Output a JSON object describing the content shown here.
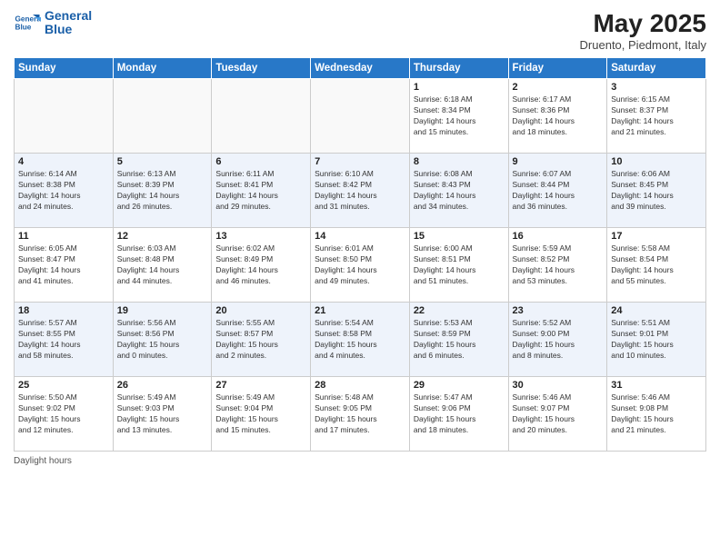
{
  "logo": {
    "text_general": "General",
    "text_blue": "Blue"
  },
  "header": {
    "month": "May 2025",
    "location": "Druento, Piedmont, Italy"
  },
  "days_of_week": [
    "Sunday",
    "Monday",
    "Tuesday",
    "Wednesday",
    "Thursday",
    "Friday",
    "Saturday"
  ],
  "weeks": [
    {
      "alt": false,
      "days": [
        {
          "num": "",
          "info": ""
        },
        {
          "num": "",
          "info": ""
        },
        {
          "num": "",
          "info": ""
        },
        {
          "num": "",
          "info": ""
        },
        {
          "num": "1",
          "info": "Sunrise: 6:18 AM\nSunset: 8:34 PM\nDaylight: 14 hours\nand 15 minutes."
        },
        {
          "num": "2",
          "info": "Sunrise: 6:17 AM\nSunset: 8:36 PM\nDaylight: 14 hours\nand 18 minutes."
        },
        {
          "num": "3",
          "info": "Sunrise: 6:15 AM\nSunset: 8:37 PM\nDaylight: 14 hours\nand 21 minutes."
        }
      ]
    },
    {
      "alt": true,
      "days": [
        {
          "num": "4",
          "info": "Sunrise: 6:14 AM\nSunset: 8:38 PM\nDaylight: 14 hours\nand 24 minutes."
        },
        {
          "num": "5",
          "info": "Sunrise: 6:13 AM\nSunset: 8:39 PM\nDaylight: 14 hours\nand 26 minutes."
        },
        {
          "num": "6",
          "info": "Sunrise: 6:11 AM\nSunset: 8:41 PM\nDaylight: 14 hours\nand 29 minutes."
        },
        {
          "num": "7",
          "info": "Sunrise: 6:10 AM\nSunset: 8:42 PM\nDaylight: 14 hours\nand 31 minutes."
        },
        {
          "num": "8",
          "info": "Sunrise: 6:08 AM\nSunset: 8:43 PM\nDaylight: 14 hours\nand 34 minutes."
        },
        {
          "num": "9",
          "info": "Sunrise: 6:07 AM\nSunset: 8:44 PM\nDaylight: 14 hours\nand 36 minutes."
        },
        {
          "num": "10",
          "info": "Sunrise: 6:06 AM\nSunset: 8:45 PM\nDaylight: 14 hours\nand 39 minutes."
        }
      ]
    },
    {
      "alt": false,
      "days": [
        {
          "num": "11",
          "info": "Sunrise: 6:05 AM\nSunset: 8:47 PM\nDaylight: 14 hours\nand 41 minutes."
        },
        {
          "num": "12",
          "info": "Sunrise: 6:03 AM\nSunset: 8:48 PM\nDaylight: 14 hours\nand 44 minutes."
        },
        {
          "num": "13",
          "info": "Sunrise: 6:02 AM\nSunset: 8:49 PM\nDaylight: 14 hours\nand 46 minutes."
        },
        {
          "num": "14",
          "info": "Sunrise: 6:01 AM\nSunset: 8:50 PM\nDaylight: 14 hours\nand 49 minutes."
        },
        {
          "num": "15",
          "info": "Sunrise: 6:00 AM\nSunset: 8:51 PM\nDaylight: 14 hours\nand 51 minutes."
        },
        {
          "num": "16",
          "info": "Sunrise: 5:59 AM\nSunset: 8:52 PM\nDaylight: 14 hours\nand 53 minutes."
        },
        {
          "num": "17",
          "info": "Sunrise: 5:58 AM\nSunset: 8:54 PM\nDaylight: 14 hours\nand 55 minutes."
        }
      ]
    },
    {
      "alt": true,
      "days": [
        {
          "num": "18",
          "info": "Sunrise: 5:57 AM\nSunset: 8:55 PM\nDaylight: 14 hours\nand 58 minutes."
        },
        {
          "num": "19",
          "info": "Sunrise: 5:56 AM\nSunset: 8:56 PM\nDaylight: 15 hours\nand 0 minutes."
        },
        {
          "num": "20",
          "info": "Sunrise: 5:55 AM\nSunset: 8:57 PM\nDaylight: 15 hours\nand 2 minutes."
        },
        {
          "num": "21",
          "info": "Sunrise: 5:54 AM\nSunset: 8:58 PM\nDaylight: 15 hours\nand 4 minutes."
        },
        {
          "num": "22",
          "info": "Sunrise: 5:53 AM\nSunset: 8:59 PM\nDaylight: 15 hours\nand 6 minutes."
        },
        {
          "num": "23",
          "info": "Sunrise: 5:52 AM\nSunset: 9:00 PM\nDaylight: 15 hours\nand 8 minutes."
        },
        {
          "num": "24",
          "info": "Sunrise: 5:51 AM\nSunset: 9:01 PM\nDaylight: 15 hours\nand 10 minutes."
        }
      ]
    },
    {
      "alt": false,
      "days": [
        {
          "num": "25",
          "info": "Sunrise: 5:50 AM\nSunset: 9:02 PM\nDaylight: 15 hours\nand 12 minutes."
        },
        {
          "num": "26",
          "info": "Sunrise: 5:49 AM\nSunset: 9:03 PM\nDaylight: 15 hours\nand 13 minutes."
        },
        {
          "num": "27",
          "info": "Sunrise: 5:49 AM\nSunset: 9:04 PM\nDaylight: 15 hours\nand 15 minutes."
        },
        {
          "num": "28",
          "info": "Sunrise: 5:48 AM\nSunset: 9:05 PM\nDaylight: 15 hours\nand 17 minutes."
        },
        {
          "num": "29",
          "info": "Sunrise: 5:47 AM\nSunset: 9:06 PM\nDaylight: 15 hours\nand 18 minutes."
        },
        {
          "num": "30",
          "info": "Sunrise: 5:46 AM\nSunset: 9:07 PM\nDaylight: 15 hours\nand 20 minutes."
        },
        {
          "num": "31",
          "info": "Sunrise: 5:46 AM\nSunset: 9:08 PM\nDaylight: 15 hours\nand 21 minutes."
        }
      ]
    }
  ],
  "footer": {
    "label": "Daylight hours"
  }
}
